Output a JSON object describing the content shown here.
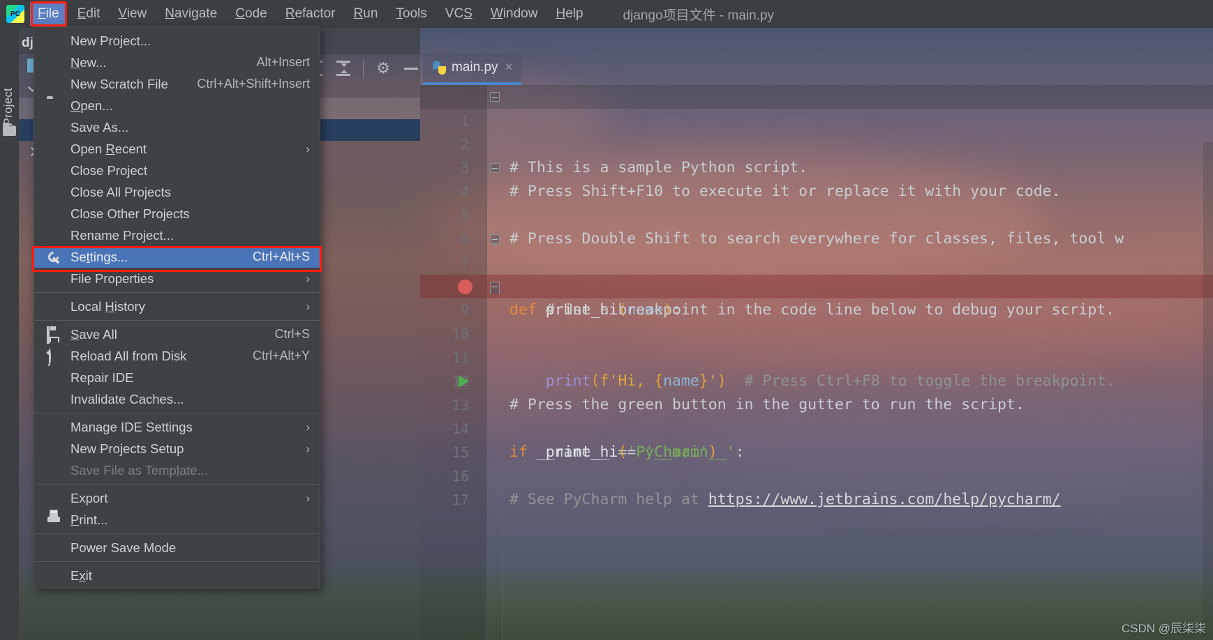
{
  "window": {
    "title": "django项目文件 - main.py",
    "logo_label": "PC"
  },
  "menubar": {
    "items": [
      {
        "label": "File",
        "mnemonic": "F",
        "active": true
      },
      {
        "label": "Edit",
        "mnemonic": "E",
        "active": false
      },
      {
        "label": "View",
        "mnemonic": "V",
        "active": false
      },
      {
        "label": "Navigate",
        "mnemonic": "N",
        "active": false
      },
      {
        "label": "Code",
        "mnemonic": "C",
        "active": false
      },
      {
        "label": "Refactor",
        "mnemonic": "R",
        "active": false
      },
      {
        "label": "Run",
        "mnemonic": "R",
        "active": false
      },
      {
        "label": "Tools",
        "mnemonic": "T",
        "active": false
      },
      {
        "label": "VCS",
        "mnemonic": "S",
        "active": false
      },
      {
        "label": "Window",
        "mnemonic": "W",
        "active": false
      },
      {
        "label": "Help",
        "mnemonic": "H",
        "active": false
      }
    ]
  },
  "file_menu": {
    "items": [
      {
        "label": "New Project...",
        "accel": "",
        "icon": "",
        "type": "item"
      },
      {
        "label": "New...",
        "accel": "Alt+Insert",
        "icon": "",
        "type": "item",
        "mnemonic": "N"
      },
      {
        "label": "New Scratch File",
        "accel": "Ctrl+Alt+Shift+Insert",
        "icon": "",
        "type": "item"
      },
      {
        "label": "Open...",
        "accel": "",
        "icon": "folder-icon",
        "type": "item",
        "mnemonic": "O"
      },
      {
        "label": "Save As...",
        "accel": "",
        "icon": "",
        "type": "item"
      },
      {
        "label": "Open Recent",
        "accel": "",
        "icon": "",
        "type": "submenu",
        "mnemonic": "R"
      },
      {
        "label": "Close Project",
        "accel": "",
        "icon": "",
        "type": "item"
      },
      {
        "label": "Close All Projects",
        "accel": "",
        "icon": "",
        "type": "item"
      },
      {
        "label": "Close Other Projects",
        "accel": "",
        "icon": "",
        "type": "item"
      },
      {
        "label": "Rename Project...",
        "accel": "",
        "icon": "",
        "type": "item"
      },
      {
        "label": "Settings...",
        "accel": "Ctrl+Alt+S",
        "icon": "wrench-icon",
        "type": "item",
        "selected": true,
        "mnemonic": "t"
      },
      {
        "label": "File Properties",
        "accel": "",
        "icon": "",
        "type": "submenu"
      },
      {
        "type": "separator"
      },
      {
        "label": "Local History",
        "accel": "",
        "icon": "",
        "type": "submenu",
        "mnemonic": "H"
      },
      {
        "type": "separator"
      },
      {
        "label": "Save All",
        "accel": "Ctrl+S",
        "icon": "save-icon",
        "type": "item",
        "mnemonic": "S"
      },
      {
        "label": "Reload All from Disk",
        "accel": "Ctrl+Alt+Y",
        "icon": "reload-icon",
        "type": "item"
      },
      {
        "label": "Repair IDE",
        "accel": "",
        "icon": "",
        "type": "item"
      },
      {
        "label": "Invalidate Caches...",
        "accel": "",
        "icon": "",
        "type": "item"
      },
      {
        "type": "separator"
      },
      {
        "label": "Manage IDE Settings",
        "accel": "",
        "icon": "",
        "type": "submenu"
      },
      {
        "label": "New Projects Setup",
        "accel": "",
        "icon": "",
        "type": "submenu"
      },
      {
        "label": "Save File as Template...",
        "accel": "",
        "icon": "",
        "type": "item",
        "disabled": true,
        "mnemonic": "l"
      },
      {
        "type": "separator"
      },
      {
        "label": "Export",
        "accel": "",
        "icon": "",
        "type": "submenu"
      },
      {
        "label": "Print...",
        "accel": "",
        "icon": "print-icon",
        "type": "item",
        "mnemonic": "P"
      },
      {
        "type": "separator"
      },
      {
        "label": "Power Save Mode",
        "accel": "",
        "icon": "",
        "type": "item"
      },
      {
        "type": "separator"
      },
      {
        "label": "Exit",
        "accel": "",
        "icon": "",
        "type": "item",
        "mnemonic": "x"
      }
    ]
  },
  "sidebar": {
    "tool_tab": "Project",
    "project_name": "django项目文件"
  },
  "editor_toolbar": {
    "expand_all": "expand-all-icon",
    "collapse_all": "collapse-all-icon",
    "settings": "gear-icon",
    "hide": "minimize-icon"
  },
  "editor": {
    "tab": {
      "label": "main.py",
      "close": "×",
      "icon": "python-file-icon"
    },
    "lines": [
      {
        "n": "1",
        "fold": "head",
        "text": "# This is a sample Python script.",
        "kind": "comment",
        "current": true
      },
      {
        "n": "2",
        "text": ""
      },
      {
        "n": "3",
        "text": "# Press Shift+F10 to execute it or replace it with your code.",
        "kind": "comment"
      },
      {
        "n": "4",
        "fold": "head",
        "text": "# Press Double Shift to search everywhere for classes, files, tool w",
        "kind": "comment"
      },
      {
        "n": "5",
        "text": ""
      },
      {
        "n": "6",
        "text": ""
      },
      {
        "n": "7",
        "fold": "head",
        "kind": "def",
        "text": "def print_hi(name):"
      },
      {
        "n": "8",
        "text": "    # Use a breakpoint in the code line below to debug your script.",
        "kind": "comment"
      },
      {
        "n": "9",
        "kind": "print",
        "breakpoint": true,
        "fold": "tail",
        "text": "    print(f'Hi, {name}')  # Press Ctrl+F8 to toggle the breakpoint."
      },
      {
        "n": "10",
        "text": ""
      },
      {
        "n": "11",
        "text": ""
      },
      {
        "n": "12",
        "text": "# Press the green button in the gutter to run the script.",
        "kind": "comment"
      },
      {
        "n": "13",
        "kind": "ifmain",
        "runmark": true,
        "text": "if __name__ == '__main__':"
      },
      {
        "n": "14",
        "kind": "callhi",
        "text": "    print_hi('PyCharm')"
      },
      {
        "n": "15",
        "text": ""
      },
      {
        "n": "16",
        "kind": "helplink",
        "text": "# See PyCharm help at https://www.jetbrains.com/help/pycharm/"
      },
      {
        "n": "17",
        "text": ""
      }
    ],
    "code_tokens": {
      "def_kw": "def",
      "def_name": "print_hi",
      "def_paren_open": "(",
      "def_param": "name",
      "def_paren_close": ")",
      "def_colon": ":",
      "print_indent": "    ",
      "print_name": "print",
      "print_open": "(",
      "print_f": "f'Hi, ",
      "print_brace_open": "{",
      "print_var": "name",
      "print_brace_close": "}",
      "print_quote": "'",
      "print_close": ")",
      "print_comment": "  # Press Ctrl+F8 to toggle the breakpoint.",
      "if_kw": "if",
      "if_name": " __name__ == ",
      "if_str": "'__main__'",
      "if_colon": ":",
      "call_indent": "    ",
      "call_name": "print_hi",
      "call_open": "(",
      "call_str": "'PyCharm'",
      "call_close": ")",
      "help_prefix": "# See PyCharm help at ",
      "help_url": "https://www.jetbrains.com/help/pycharm/"
    }
  },
  "watermark": {
    "text": "CSDN @辰柒柒"
  },
  "colors": {
    "menu_bg": "#3f4244",
    "menu_selection": "#4a74b8",
    "highlight_red": "#ff1d0f",
    "menubar_bg": "#3c3f41",
    "tab_underline": "#4a88c7",
    "keyword_orange": "#e08a3c",
    "string_green": "#79ab5a",
    "comment_grey": "#8f9296",
    "breakpoint_red": "#db5c5c",
    "run_green": "#4caf50"
  }
}
